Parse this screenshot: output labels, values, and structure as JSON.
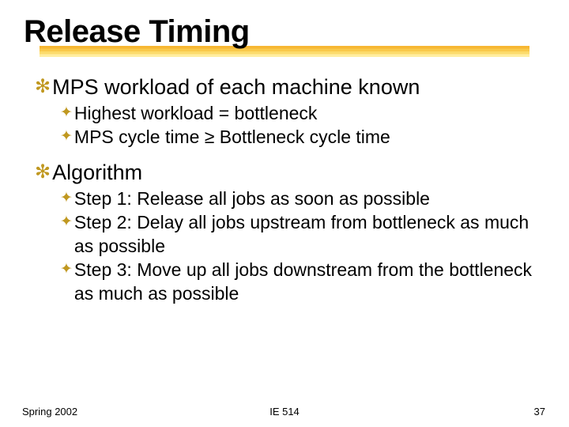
{
  "title": "Release Timing",
  "bullets": [
    {
      "text": "MPS workload of each machine known",
      "sub": [
        "Highest workload = bottleneck",
        "MPS cycle time ≥ Bottleneck cycle time"
      ]
    },
    {
      "text": "Algorithm",
      "sub": [
        "Step 1: Release all jobs as soon as possible",
        "Step 2: Delay all jobs upstream from bottleneck as much as possible",
        "Step 3: Move up all jobs downstream from the bottleneck as much as possible"
      ]
    }
  ],
  "footer": {
    "left": "Spring 2002",
    "center": "IE 514",
    "right": "37"
  },
  "glyphs": {
    "l1_bullet": "✻",
    "l2_bullet": "✦"
  }
}
